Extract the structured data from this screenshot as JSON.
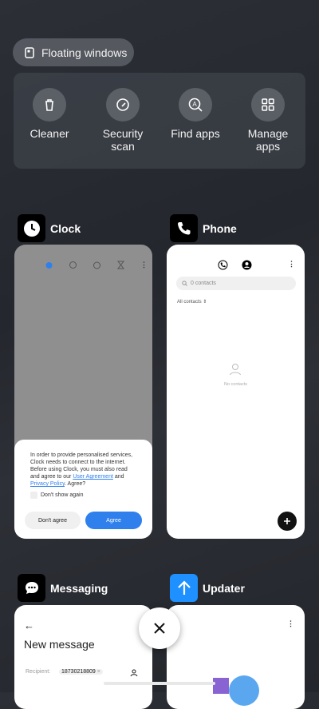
{
  "floating_windows": {
    "label": "Floating windows"
  },
  "quick_actions": [
    {
      "label": "Cleaner",
      "icon": "trash-icon"
    },
    {
      "label": "Security\nscan",
      "icon": "shield-check-icon"
    },
    {
      "label": "Find apps",
      "icon": "search-apps-icon"
    },
    {
      "label": "Manage\napps",
      "icon": "grid-icon"
    }
  ],
  "apps": {
    "clock": {
      "name": "Clock",
      "dialog_text": "In order to provide personalised services, Clock needs to connect to the internet. Before using Clock, you must also read and agree to our ",
      "user_agreement": "User Agreement",
      "and": " and ",
      "privacy_policy": "Privacy Policy",
      "agree_q": ". Agree?",
      "dont_show": "Don't show again",
      "dont_agree": "Don't agree",
      "agree": "Agree"
    },
    "phone": {
      "name": "Phone",
      "search_placeholder": "0 contacts",
      "filter": "All contacts",
      "empty": "No contacts"
    },
    "messaging": {
      "name": "Messaging",
      "title": "New message",
      "recipient_label": "Recipient:",
      "recipient_value": "18730218809"
    },
    "updater": {
      "name": "Updater"
    }
  },
  "colors": {
    "accent": "#2f80ed",
    "clock_bg": "#8f8f8f"
  }
}
